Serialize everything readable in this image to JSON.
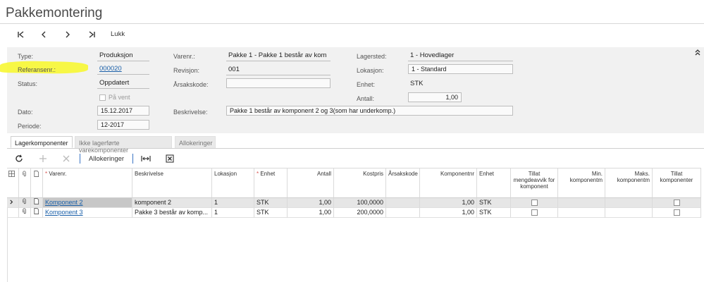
{
  "page": {
    "title": "Pakkemontering"
  },
  "nav": {
    "first": "first-icon",
    "prev": "prev-icon",
    "next": "next-icon",
    "last": "last-icon",
    "close_label": "Lukk"
  },
  "form": {
    "type": {
      "label": "Type:",
      "value": "Produksjon"
    },
    "ref": {
      "label": "Referansenr.:",
      "value": "000020"
    },
    "status": {
      "label": "Status:",
      "value": "Oppdatert"
    },
    "on_hold": {
      "label": "På vent"
    },
    "date": {
      "label": "Dato:",
      "value": "15.12.2017"
    },
    "period": {
      "label": "Periode:",
      "value": "12-2017"
    },
    "item": {
      "label": "Varenr.:",
      "value": "Pakke 1 - Pakke 1 består av kom"
    },
    "revision": {
      "label": "Revisjon:",
      "value": "001"
    },
    "reason": {
      "label": "Årsakskode:",
      "value": ""
    },
    "description": {
      "label": "Beskrivelse:",
      "value": "Pakke 1 består av komponent 2 og 3(som har underkomp.)"
    },
    "warehouse": {
      "label": "Lagersted:",
      "value": "1 - Hovedlager"
    },
    "location": {
      "label": "Lokasjon:",
      "value": "1 - Standard"
    },
    "unit": {
      "label": "Enhet:",
      "value": "STK"
    },
    "qty": {
      "label": "Antall:",
      "value": "1,00"
    }
  },
  "tabs": [
    {
      "label": "Lagerkomponenter"
    },
    {
      "label": "Ikke lagerførte varekomponenter"
    },
    {
      "label": "Allokeringer"
    }
  ],
  "toolbar": {
    "allocations_label": "Allokeringer"
  },
  "grid": {
    "headers": {
      "item": "Varenr.",
      "desc": "Beskrivelse",
      "loc": "Lokasjon",
      "unit": "Enhet",
      "qty": "Antall",
      "cost": "Kostpris",
      "reason": "Årsakskode",
      "compnr": "Komponentnr",
      "unit2": "Enhet",
      "allow": "Tillat mengdeavvik for komponent",
      "min": "Min. komponentm",
      "max": "Maks. komponentm",
      "allow2": "Tillat komponenter"
    },
    "rows": [
      {
        "item": "Komponent 2",
        "desc": "komponent 2",
        "loc": "1",
        "unit": "STK",
        "qty": "1,00",
        "cost": "100,0000",
        "reason": "",
        "compnr": "1,00",
        "unit2": "STK"
      },
      {
        "item": "Komponent 3",
        "desc": "Pakke 3 består av komp...",
        "loc": "1",
        "unit": "STK",
        "qty": "1,00",
        "cost": "200,0000",
        "reason": "",
        "compnr": "1,00",
        "unit2": "STK"
      }
    ]
  },
  "colors": {
    "highlight": "#f7f733",
    "link": "#1a5fa8",
    "separator": "#3a74c4"
  }
}
